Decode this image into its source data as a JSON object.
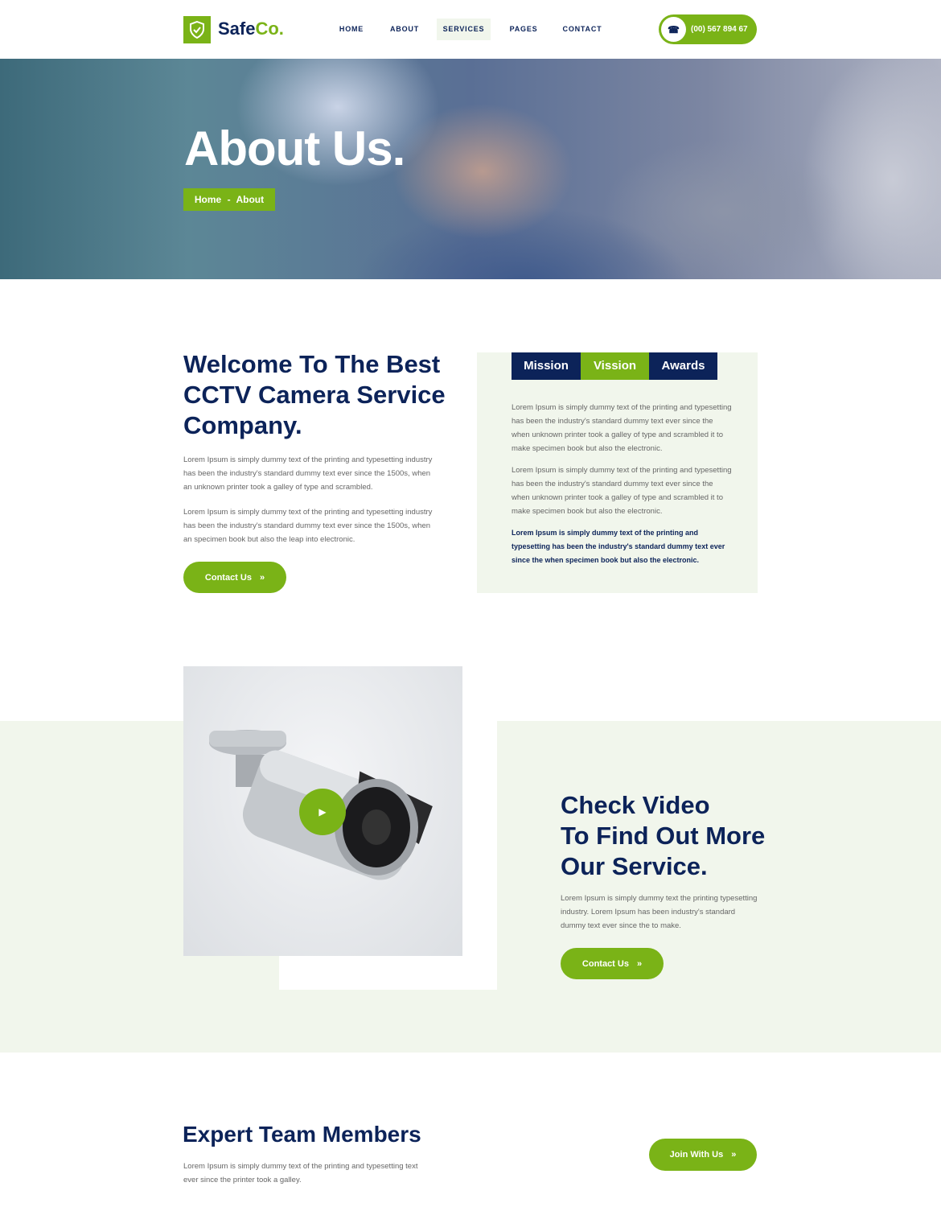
{
  "header": {
    "logo": {
      "text_main": "Safe",
      "text_accent": "Co."
    },
    "nav": [
      {
        "label": "HOME"
      },
      {
        "label": "ABOUT"
      },
      {
        "label": "SERVICES",
        "active": true
      },
      {
        "label": "PAGES"
      },
      {
        "label": "CONTACT"
      }
    ],
    "phone": "(00) 567 894 67"
  },
  "hero": {
    "title": "About Us.",
    "breadcrumb": {
      "home": "Home",
      "sep": "-",
      "current": "About"
    }
  },
  "welcome": {
    "heading_lines": [
      "Welcome To The Best",
      "CCTV Camera Service",
      "Company."
    ],
    "paragraphs": [
      "Lorem Ipsum is simply dummy text of the printing and typesetting industry has been the industry's standard dummy text ever since the 1500s, when an unknown printer took a galley of type and scrambled.",
      "Lorem Ipsum is simply dummy text of the printing and typesetting industry has been the industry's standard dummy text ever since the 1500s, when an specimen book but also the leap into electronic."
    ],
    "button": "Contact Us"
  },
  "tabs": {
    "items": [
      {
        "label": "Mission"
      },
      {
        "label": "Vission",
        "active": true
      },
      {
        "label": "Awards"
      }
    ],
    "paragraphs": [
      "Lorem Ipsum is simply dummy text of the printing and typesetting has been the industry's standard dummy text ever since the when unknown printer took a galley of type and scrambled it to make specimen book but also the electronic.",
      "Lorem Ipsum is simply dummy text of the printing and typesetting has been the industry's standard dummy text ever since the when unknown printer took a galley of type and scrambled it to make specimen book but also the electronic."
    ],
    "bold_paragraph": "Lorem Ipsum is simply dummy text of the printing and typesetting has been the industry's standard dummy text ever since the when specimen book but also the electronic."
  },
  "video": {
    "heading_lines": [
      "Check Video",
      "To Find Out More",
      "Our Service."
    ],
    "paragraph": "Lorem Ipsum is simply dummy text the printing typesetting industry. Lorem Ipsum has been industry's standard dummy text ever since the to make.",
    "button": "Contact Us"
  },
  "team": {
    "heading": "Expert Team Members",
    "paragraph": "Lorem Ipsum is simply dummy text of the printing and typesetting text ever since the printer took a galley.",
    "button": "Join With Us"
  },
  "colors": {
    "navy": "#0c2359",
    "green": "#7ab317",
    "light": "#f1f6ec"
  }
}
